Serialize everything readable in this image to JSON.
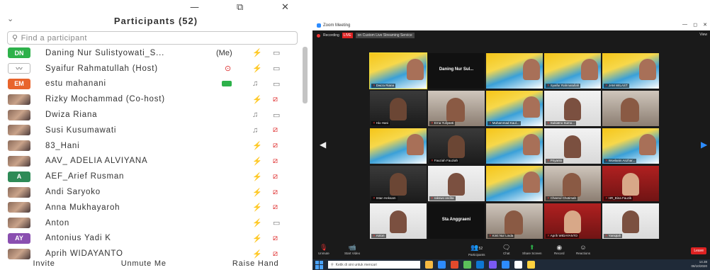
{
  "panel": {
    "title": "Participants (52)",
    "search_placeholder": "Find a participant",
    "window_controls": {
      "minimize": "—",
      "restore": "⧉",
      "close": "✕"
    },
    "participants": [
      {
        "initials": "DN",
        "avatar_color": "#2db14a",
        "photo": false,
        "name": "Daning Nur Sulistyowati_S...",
        "extra": "(Me)",
        "mic": "muted",
        "cam": "on"
      },
      {
        "initials": "",
        "avatar_color": "#ffffff",
        "photo": false,
        "name": "Syaifur Rahmatullah (Host)",
        "extra": "",
        "mic": "muted",
        "cam": "on",
        "screen_share": true
      },
      {
        "initials": "EM",
        "avatar_color": "#e8642c",
        "photo": false,
        "name": "estu mahanani",
        "extra": "",
        "mic": "on",
        "cam": "on",
        "video_badge": true
      },
      {
        "initials": "",
        "avatar_color": "#8a6a5a",
        "photo": true,
        "name": "Rizky Mochammad (Co-host)",
        "extra": "",
        "mic": "muted",
        "cam": "off"
      },
      {
        "initials": "",
        "avatar_color": "#8a6a5a",
        "photo": true,
        "name": "Dwiza Riana",
        "extra": "",
        "mic": "on",
        "cam": "on"
      },
      {
        "initials": "",
        "avatar_color": "#8a6a5a",
        "photo": true,
        "name": "Susi Kusumawati",
        "extra": "",
        "mic": "on",
        "cam": "off"
      },
      {
        "initials": "",
        "avatar_color": "#8a6a5a",
        "photo": true,
        "name": "83_Hani",
        "extra": "",
        "mic": "muted",
        "cam": "off"
      },
      {
        "initials": "",
        "avatar_color": "#8a6a5a",
        "photo": true,
        "name": "AAV_ ADELIA ALVIYANA",
        "extra": "",
        "mic": "muted",
        "cam": "off"
      },
      {
        "initials": "A",
        "avatar_color": "#2e8b57",
        "photo": false,
        "name": "AEF_Arief Rusman",
        "extra": "",
        "mic": "muted",
        "cam": "off"
      },
      {
        "initials": "",
        "avatar_color": "#8a6a5a",
        "photo": true,
        "name": "Andi Saryoko",
        "extra": "",
        "mic": "muted",
        "cam": "off"
      },
      {
        "initials": "",
        "avatar_color": "#8a6a5a",
        "photo": true,
        "name": "Anna Mukhayaroh",
        "extra": "",
        "mic": "muted",
        "cam": "off"
      },
      {
        "initials": "",
        "avatar_color": "#8a6a5a",
        "photo": true,
        "name": "Anton",
        "extra": "",
        "mic": "muted",
        "cam": "on"
      },
      {
        "initials": "AY",
        "avatar_color": "#8a4fb0",
        "photo": false,
        "name": "Antonius Yadi K",
        "extra": "",
        "mic": "muted",
        "cam": "off"
      },
      {
        "initials": "",
        "avatar_color": "#8a6a5a",
        "photo": true,
        "name": "Aprih WIDAYANTO",
        "extra": "",
        "mic": "muted",
        "cam": "off"
      }
    ],
    "bottom": {
      "invite": "Invite",
      "unmute": "Unmute Me",
      "raise": "Raise Hand"
    }
  },
  "zoom": {
    "window_title": "Zoom Meeting",
    "recording_label": "Recording",
    "live_label": "LIVE",
    "live_service": "on Custom Live Streaming Service",
    "view_label": "View",
    "tiles": [
      {
        "type": "webinar",
        "name": "Dwiza Riana",
        "active": true
      },
      {
        "type": "black",
        "big": "Daning Nur Sul...",
        "name": ""
      },
      {
        "type": "webinar",
        "name": ""
      },
      {
        "type": "webinar",
        "name": "Syaifur Rahmatullah"
      },
      {
        "type": "webinar",
        "name": "JAM WILAST"
      },
      {
        "type": "dark",
        "name": "Hio Hani"
      },
      {
        "type": "cam",
        "name": "Erna Yuliyanti"
      },
      {
        "type": "webinar",
        "name": "Muhammad Kaul..."
      },
      {
        "type": "light",
        "name": "Sukiatno Sumo..."
      },
      {
        "type": "cam",
        "name": ""
      },
      {
        "type": "webinar",
        "name": ""
      },
      {
        "type": "dark",
        "name": "Fauziah Fauziah"
      },
      {
        "type": "webinar",
        "name": ""
      },
      {
        "type": "light",
        "name": "Priyanto"
      },
      {
        "type": "webinar",
        "name": "Woelanin Anzhar..."
      },
      {
        "type": "dark",
        "name": "Intan Heksam"
      },
      {
        "type": "light",
        "name": "rakswo andita"
      },
      {
        "type": "webinar",
        "name": ""
      },
      {
        "type": "cam",
        "name": "Cheerul Chotimah"
      },
      {
        "type": "red",
        "name": "HR_Bina Fauzik"
      },
      {
        "type": "light",
        "name": "Anton"
      },
      {
        "type": "black",
        "big": "Sta Anggraeni",
        "name": ""
      },
      {
        "type": "cam",
        "name": "Kinti Nur Linda"
      },
      {
        "type": "red",
        "name": "Aprih WIDAYANTO"
      },
      {
        "type": "light",
        "name": "Yaniqtah"
      }
    ],
    "controls": {
      "unmute": "Unmute",
      "video": "Start Video",
      "participants": "Participants",
      "participant_count": "52",
      "chat": "Chat",
      "share": "Share Screen",
      "record": "Record",
      "reactions": "Reactions",
      "end": "Leave"
    },
    "taskbar": {
      "search": "Ketik di sini untuk mencari",
      "time": "14.38",
      "date": "08/10/2020",
      "app_colors": [
        "#f5b942",
        "#2d8cff",
        "#e34a2c",
        "#5bbf5a",
        "#0e77d4",
        "#7a5af5",
        "#2d8cff",
        "#ffffff",
        "#ffd23f"
      ]
    }
  },
  "colors": {
    "mute_red": "#d22222",
    "green": "#2db14a",
    "zoom_blue": "#2d8cff"
  }
}
